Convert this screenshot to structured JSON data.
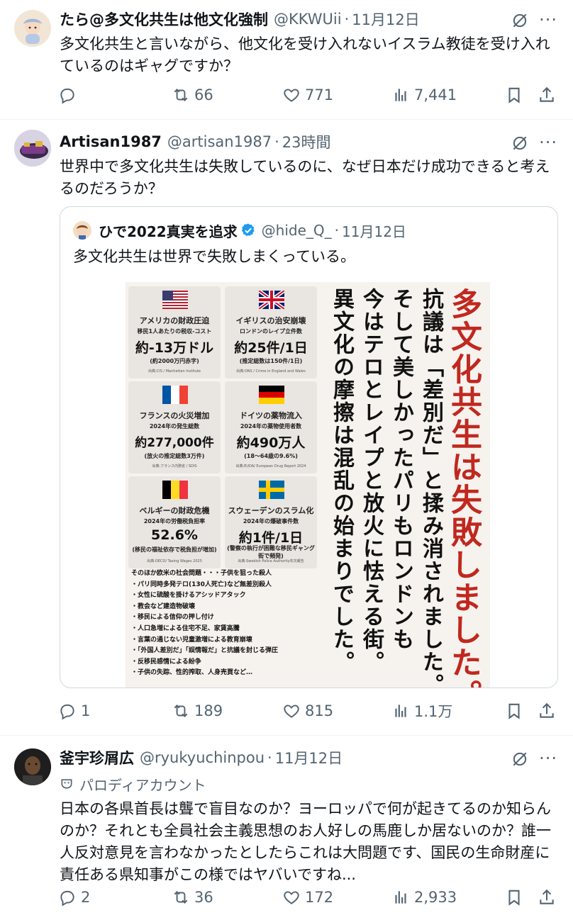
{
  "tweets": [
    {
      "display_name": "たら@多文化共生は他文化強制",
      "handle": "@KKWUii",
      "time": "11月12日",
      "text": "多文化共生と言いながら、他文化を受け入れないイスラム教徒を受け入れているのはギャグですか？",
      "stats": {
        "reply": "",
        "retweet": "66",
        "like": "771",
        "views": "7,441"
      }
    },
    {
      "display_name": "Artisan1987",
      "handle": "@artisan1987",
      "time": "23時間",
      "text": "世界中で多文化共生は失敗しているのに、なぜ日本だけ成功できると考えるのだろうか？",
      "quote": {
        "display_name": "ひで2022真実を追求",
        "handle": "@hide_Q_",
        "time": "11月12日",
        "text": "多文化共生は世界で失敗しまくっている。",
        "infographic": {
          "cells": [
            {
              "flag": "us-flag",
              "title": "アメリカの財政圧迫",
              "sub": "移民1人あたりの税収-コスト",
              "big": "約-13万ドル",
              "note": "(約2000万円赤字)",
              "src": "出典:CIS / Manhattan Institute"
            },
            {
              "flag": "uk-flag",
              "title": "イギリスの治安崩壊",
              "sub": "ロンドンのレイプ立件数",
              "big": "約25件/1日",
              "note": "(推定総数は150件/1日)",
              "src": "出典:ONS / Crime in England and Wales"
            },
            {
              "flag": "fr-flag",
              "title": "フランスの火災増加",
              "sub": "2024年の発生総数",
              "big": "約277,000件",
              "note": "(放火の推定総数3万件)",
              "src": "出典:フランス内務省 / SDIS"
            },
            {
              "flag": "de-flag",
              "title": "ドイツの薬物流入",
              "sub": "2024年の薬物使用者数",
              "big": "約490万人",
              "note": "(18〜64歳の9.6%)",
              "src": "出典:EUDA/ European Drug Report 2024"
            },
            {
              "flag": "be-flag",
              "title": "ベルギーの財政危機",
              "sub": "2024年の労働税負担率",
              "big": "52.6%",
              "note": "(移民の福祉依存で税負担が増加)",
              "src": "出典:OECD/ Taxing Wages 2025"
            },
            {
              "flag": "se-flag",
              "title": "スウェーデンのスラム化",
              "sub": "2024年の爆破事件数",
              "big": "約1件/1日",
              "note": "(警察の執行が困難な移民ギャング街で頻発)",
              "src": "出典:Swedish Police Authority年次報告"
            }
          ],
          "misc_lines": [
            "そのほか欧米の社会問題・・・子供を狙った殺人",
            "・パリ同時多発テロ(130人死亡)など無差別殺人",
            "・女性に硫酸を掛けるアシッドアタック",
            "・教会など建造物破壊",
            "・移民による信仰の押し付け",
            "・人口急増による住宅不足、家賃高騰",
            "・言葉の通じない児童激増による教育崩壊",
            "・「外国人差別だ」「誤情報だ」と抗議を封じる弾圧",
            "・反移民感情による紛争",
            "・子供の失踪、性的搾取、人身売買など…"
          ],
          "headline_1": "多文化共生は失敗しました。",
          "headline_2": "抗議は「差別だ」と揉み消されました。",
          "headline_3": "そして美しかったパリもロンドンも",
          "headline_4": "今はテロとレイプと放火に怯える街。",
          "headline_5": "異文化の摩擦は混乱の始まりでした。"
        }
      },
      "stats": {
        "reply": "1",
        "retweet": "189",
        "like": "815",
        "views": "1.1万"
      }
    },
    {
      "display_name": "釜宇珍屑広",
      "handle": "@ryukyuchinpou",
      "time": "11月12日",
      "parody_label": "パロディアカウント",
      "text": "日本の各県首長は聾で盲目なのか？ヨーロッパで何が起きてるのか知らんのか？それとも全員社会主義思想のお人好しの馬鹿しか居ないのか？誰一人反対意見を言わなかったとしたらこれは大問題です、国民の生命財産に責任ある県知事がこの様ではヤバいですね...",
      "stats": {
        "reply": "2",
        "retweet": "36",
        "like": "172",
        "views": "2,933"
      }
    }
  ],
  "colors": {
    "text": "#0f1419",
    "muted": "#536471",
    "border": "#cfd9de",
    "verified": "#1d9bf0",
    "accent_red": "#c0281f"
  },
  "icons": [
    "grok-icon",
    "more-icon",
    "reply-icon",
    "retweet-icon",
    "like-icon",
    "views-icon",
    "bookmark-icon",
    "share-icon",
    "verified-badge-icon",
    "parody-mask-icon"
  ]
}
